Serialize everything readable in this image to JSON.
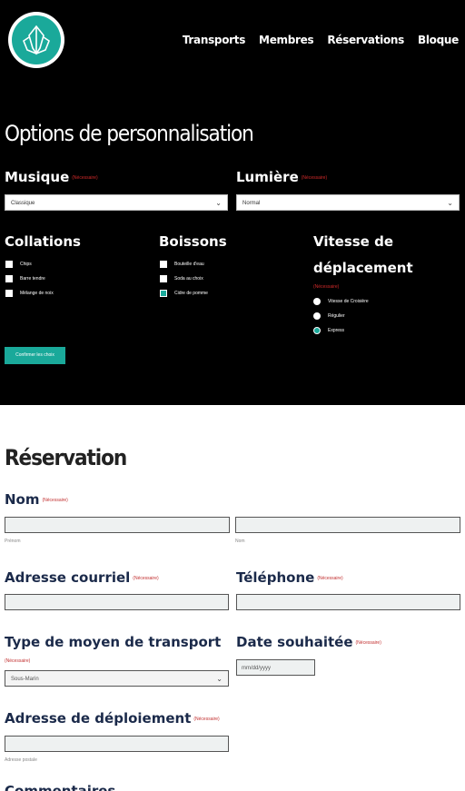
{
  "nav": {
    "items": [
      "Transports",
      "Membres",
      "Réservations",
      "Bloque"
    ]
  },
  "customization": {
    "title": "Options de personnalisation",
    "required": "(Nécessaire)",
    "music": {
      "label": "Musique",
      "value": "Classique"
    },
    "light": {
      "label": "Lumière",
      "value": "Normal"
    },
    "snacks": {
      "label": "Collations",
      "options": [
        "Chips",
        "Barre tendre",
        "Mélange de noix"
      ]
    },
    "drinks": {
      "label": "Boissons",
      "options": [
        "Bouteille d'eau",
        "Soda au choix",
        "Cidre de pomme"
      ]
    },
    "speed": {
      "label_line1": "Vitesse de",
      "label_line2": "déplacement",
      "options": [
        "Vitesse de Croisière",
        "Régulier",
        "Express"
      ]
    },
    "confirm": "Confirmer les choix"
  },
  "reservation": {
    "title": "Réservation",
    "required": "(Nécessaire)",
    "name": {
      "label": "Nom",
      "first_sub": "Prénom",
      "last_sub": "Nom"
    },
    "email": {
      "label": "Adresse courriel"
    },
    "phone": {
      "label": "Téléphone"
    },
    "transport_type": {
      "label": "Type de moyen de transport",
      "value": "Sous-Marin"
    },
    "date": {
      "label": "Date souhaitée",
      "placeholder": "mm/dd/yyyy"
    },
    "deploy": {
      "label": "Adresse de déploiement",
      "sub": "Adresse postale"
    },
    "comments_label": "Commentaires"
  },
  "colors": {
    "accent": "#1aa99a",
    "required": "#d12a2a",
    "label": "#1b2a4a"
  }
}
